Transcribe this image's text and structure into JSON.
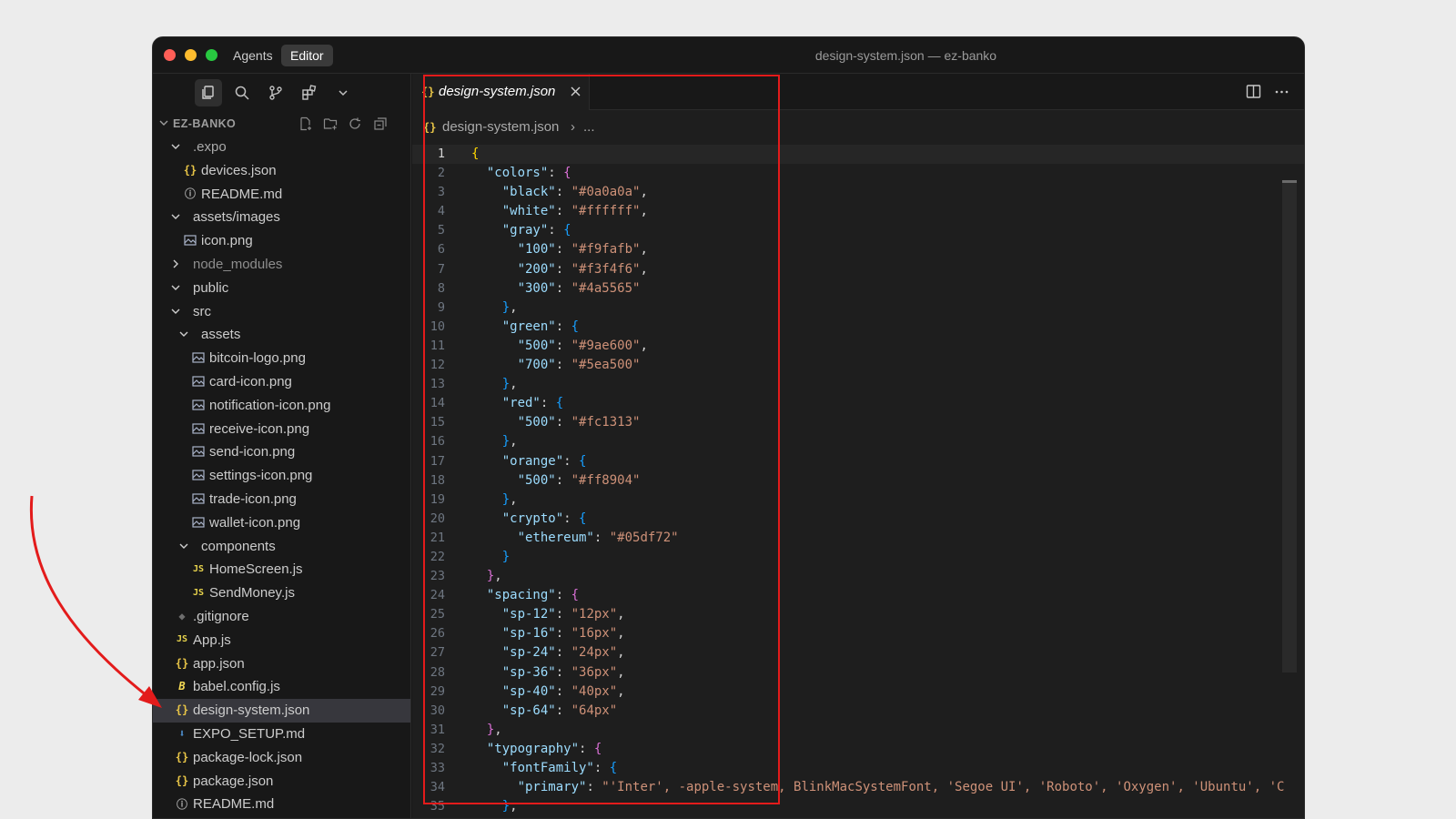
{
  "window": {
    "modes": [
      "Agents",
      "Editor"
    ],
    "title": "design-system.json — ez-banko"
  },
  "explorer": {
    "project": "EZ-BANKO",
    "tree": [
      {
        "label": ".expo",
        "type": "folder-open",
        "depth": 1,
        "icon": "chevron-down-icon"
      },
      {
        "label": "devices.json",
        "type": "json",
        "depth": 2
      },
      {
        "label": "README.md",
        "type": "info",
        "depth": 2
      },
      {
        "label": "assets/images",
        "type": "folder-open",
        "depth": 1
      },
      {
        "label": "icon.png",
        "type": "image",
        "depth": 2
      },
      {
        "label": "node_modules",
        "type": "folder-closed",
        "depth": 1
      },
      {
        "label": "public",
        "type": "folder-open",
        "depth": 1
      },
      {
        "label": "src",
        "type": "folder-open",
        "depth": 1
      },
      {
        "label": "assets",
        "type": "folder-open",
        "depth": 2
      },
      {
        "label": "bitcoin-logo.png",
        "type": "image",
        "depth": 3
      },
      {
        "label": "card-icon.png",
        "type": "image",
        "depth": 3
      },
      {
        "label": "notification-icon.png",
        "type": "image",
        "depth": 3
      },
      {
        "label": "receive-icon.png",
        "type": "image",
        "depth": 3
      },
      {
        "label": "send-icon.png",
        "type": "image",
        "depth": 3
      },
      {
        "label": "settings-icon.png",
        "type": "image",
        "depth": 3
      },
      {
        "label": "trade-icon.png",
        "type": "image",
        "depth": 3
      },
      {
        "label": "wallet-icon.png",
        "type": "image",
        "depth": 3
      },
      {
        "label": "components",
        "type": "folder-open",
        "depth": 2
      },
      {
        "label": "HomeScreen.js",
        "type": "js",
        "depth": 3
      },
      {
        "label": "SendMoney.js",
        "type": "js",
        "depth": 3
      },
      {
        "label": ".gitignore",
        "type": "git",
        "depth": 1
      },
      {
        "label": "App.js",
        "type": "js",
        "depth": 1
      },
      {
        "label": "app.json",
        "type": "json",
        "depth": 1
      },
      {
        "label": "babel.config.js",
        "type": "babel",
        "depth": 1
      },
      {
        "label": "design-system.json",
        "type": "json",
        "depth": 1,
        "selected": true
      },
      {
        "label": "EXPO_SETUP.md",
        "type": "md",
        "depth": 1
      },
      {
        "label": "package-lock.json",
        "type": "json",
        "depth": 1
      },
      {
        "label": "package.json",
        "type": "json",
        "depth": 1
      },
      {
        "label": "README.md",
        "type": "info",
        "depth": 1
      }
    ]
  },
  "tab": {
    "label": "design-system.json",
    "icon": "{}"
  },
  "breadcrumb": {
    "icon": "{}",
    "file": "design-system.json",
    "separator": "›",
    "more": "..."
  },
  "code": {
    "current_line": 1,
    "lines": [
      [
        [
          "b1",
          "{"
        ]
      ],
      [
        [
          "i",
          "  "
        ],
        [
          "k",
          "\"colors\""
        ],
        [
          "p",
          ": "
        ],
        [
          "b2",
          "{"
        ]
      ],
      [
        [
          "i",
          "    "
        ],
        [
          "k",
          "\"black\""
        ],
        [
          "p",
          ": "
        ],
        [
          "s",
          "\"#0a0a0a\""
        ],
        [
          "p",
          ","
        ]
      ],
      [
        [
          "i",
          "    "
        ],
        [
          "k",
          "\"white\""
        ],
        [
          "p",
          ": "
        ],
        [
          "s",
          "\"#ffffff\""
        ],
        [
          "p",
          ","
        ]
      ],
      [
        [
          "i",
          "    "
        ],
        [
          "k",
          "\"gray\""
        ],
        [
          "p",
          ": "
        ],
        [
          "b3",
          "{"
        ]
      ],
      [
        [
          "i",
          "      "
        ],
        [
          "k",
          "\"100\""
        ],
        [
          "p",
          ": "
        ],
        [
          "s",
          "\"#f9fafb\""
        ],
        [
          "p",
          ","
        ]
      ],
      [
        [
          "i",
          "      "
        ],
        [
          "k",
          "\"200\""
        ],
        [
          "p",
          ": "
        ],
        [
          "s",
          "\"#f3f4f6\""
        ],
        [
          "p",
          ","
        ]
      ],
      [
        [
          "i",
          "      "
        ],
        [
          "k",
          "\"300\""
        ],
        [
          "p",
          ": "
        ],
        [
          "s",
          "\"#4a5565\""
        ]
      ],
      [
        [
          "i",
          "    "
        ],
        [
          "b3",
          "}"
        ],
        [
          "p",
          ","
        ]
      ],
      [
        [
          "i",
          "    "
        ],
        [
          "k",
          "\"green\""
        ],
        [
          "p",
          ": "
        ],
        [
          "b3",
          "{"
        ]
      ],
      [
        [
          "i",
          "      "
        ],
        [
          "k",
          "\"500\""
        ],
        [
          "p",
          ": "
        ],
        [
          "s",
          "\"#9ae600\""
        ],
        [
          "p",
          ","
        ]
      ],
      [
        [
          "i",
          "      "
        ],
        [
          "k",
          "\"700\""
        ],
        [
          "p",
          ": "
        ],
        [
          "s",
          "\"#5ea500\""
        ]
      ],
      [
        [
          "i",
          "    "
        ],
        [
          "b3",
          "}"
        ],
        [
          "p",
          ","
        ]
      ],
      [
        [
          "i",
          "    "
        ],
        [
          "k",
          "\"red\""
        ],
        [
          "p",
          ": "
        ],
        [
          "b3",
          "{"
        ]
      ],
      [
        [
          "i",
          "      "
        ],
        [
          "k",
          "\"500\""
        ],
        [
          "p",
          ": "
        ],
        [
          "s",
          "\"#fc1313\""
        ]
      ],
      [
        [
          "i",
          "    "
        ],
        [
          "b3",
          "}"
        ],
        [
          "p",
          ","
        ]
      ],
      [
        [
          "i",
          "    "
        ],
        [
          "k",
          "\"orange\""
        ],
        [
          "p",
          ": "
        ],
        [
          "b3",
          "{"
        ]
      ],
      [
        [
          "i",
          "      "
        ],
        [
          "k",
          "\"500\""
        ],
        [
          "p",
          ": "
        ],
        [
          "s",
          "\"#ff8904\""
        ]
      ],
      [
        [
          "i",
          "    "
        ],
        [
          "b3",
          "}"
        ],
        [
          "p",
          ","
        ]
      ],
      [
        [
          "i",
          "    "
        ],
        [
          "k",
          "\"crypto\""
        ],
        [
          "p",
          ": "
        ],
        [
          "b3",
          "{"
        ]
      ],
      [
        [
          "i",
          "      "
        ],
        [
          "k",
          "\"ethereum\""
        ],
        [
          "p",
          ": "
        ],
        [
          "s",
          "\"#05df72\""
        ]
      ],
      [
        [
          "i",
          "    "
        ],
        [
          "b3",
          "}"
        ]
      ],
      [
        [
          "i",
          "  "
        ],
        [
          "b2",
          "}"
        ],
        [
          "p",
          ","
        ]
      ],
      [
        [
          "i",
          "  "
        ],
        [
          "k",
          "\"spacing\""
        ],
        [
          "p",
          ": "
        ],
        [
          "b2",
          "{"
        ]
      ],
      [
        [
          "i",
          "    "
        ],
        [
          "k",
          "\"sp-12\""
        ],
        [
          "p",
          ": "
        ],
        [
          "s",
          "\"12px\""
        ],
        [
          "p",
          ","
        ]
      ],
      [
        [
          "i",
          "    "
        ],
        [
          "k",
          "\"sp-16\""
        ],
        [
          "p",
          ": "
        ],
        [
          "s",
          "\"16px\""
        ],
        [
          "p",
          ","
        ]
      ],
      [
        [
          "i",
          "    "
        ],
        [
          "k",
          "\"sp-24\""
        ],
        [
          "p",
          ": "
        ],
        [
          "s",
          "\"24px\""
        ],
        [
          "p",
          ","
        ]
      ],
      [
        [
          "i",
          "    "
        ],
        [
          "k",
          "\"sp-36\""
        ],
        [
          "p",
          ": "
        ],
        [
          "s",
          "\"36px\""
        ],
        [
          "p",
          ","
        ]
      ],
      [
        [
          "i",
          "    "
        ],
        [
          "k",
          "\"sp-40\""
        ],
        [
          "p",
          ": "
        ],
        [
          "s",
          "\"40px\""
        ],
        [
          "p",
          ","
        ]
      ],
      [
        [
          "i",
          "    "
        ],
        [
          "k",
          "\"sp-64\""
        ],
        [
          "p",
          ": "
        ],
        [
          "s",
          "\"64px\""
        ]
      ],
      [
        [
          "i",
          "  "
        ],
        [
          "b2",
          "}"
        ],
        [
          "p",
          ","
        ]
      ],
      [
        [
          "i",
          "  "
        ],
        [
          "k",
          "\"typography\""
        ],
        [
          "p",
          ": "
        ],
        [
          "b2",
          "{"
        ]
      ],
      [
        [
          "i",
          "    "
        ],
        [
          "k",
          "\"fontFamily\""
        ],
        [
          "p",
          ": "
        ],
        [
          "b3",
          "{"
        ]
      ],
      [
        [
          "i",
          "      "
        ],
        [
          "k",
          "\"primary\""
        ],
        [
          "p",
          ": "
        ],
        [
          "s",
          "\"'Inter', -apple-system, BlinkMacSystemFont, 'Segoe UI', 'Roboto', 'Oxygen', 'Ubuntu', 'C"
        ]
      ],
      [
        [
          "i",
          "    "
        ],
        [
          "b3",
          "}"
        ],
        [
          "p",
          ","
        ]
      ]
    ]
  },
  "annotation": {
    "color": "#e31b1b"
  }
}
